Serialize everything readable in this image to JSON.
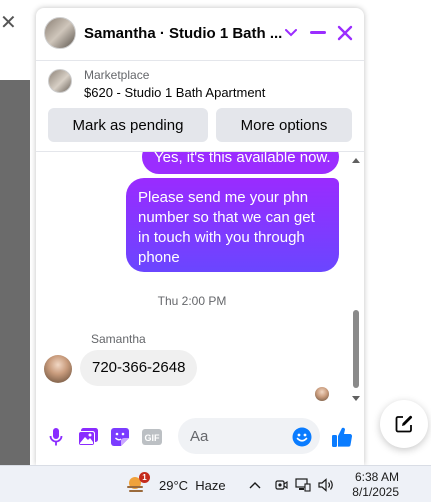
{
  "chat": {
    "contact_title": "Samantha · Studio 1 Bath ...",
    "marketplace_label": "Marketplace",
    "listing": "$620 - Studio 1 Bath Apartment",
    "buttons": {
      "mark_pending": "Mark as pending",
      "more_options": "More options"
    },
    "messages": {
      "partial_outgoing": "Yes, it's this available now.",
      "outgoing": "Please send me your phn number so that we can get in touch with you through phone",
      "timestamp": "Thu 2:00 PM",
      "sender_name": "Samantha",
      "incoming": "720-366-2648"
    },
    "composer": {
      "placeholder": "Aa"
    },
    "accent_color": "#8a2bff",
    "header_icon_color": "#9b2dff"
  },
  "taskbar": {
    "weather_badge": "1",
    "temperature": "29°C",
    "condition": "Haze",
    "time": "6:38 AM",
    "date": "8/1/2025"
  }
}
